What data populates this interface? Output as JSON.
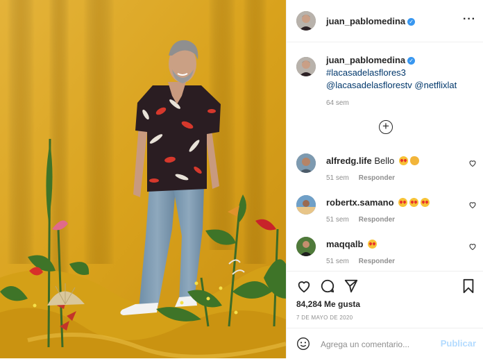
{
  "header": {
    "username": "juan_pablomedina",
    "verified_icon": "verified-badge-icon",
    "more_icon": "more-options-icon"
  },
  "caption": {
    "username": "juan_pablomedina",
    "lines": [
      "#lacasadelasflores3",
      "@lacasadelasflorestv",
      "@netflixlat"
    ],
    "time": "64 sem"
  },
  "load_more_icon": "plus-circle-icon",
  "comments": [
    {
      "username": "alfredg.life",
      "text": "Bello",
      "emojis": [
        "heart-eyes-emoji",
        "clapping-hands-emoji"
      ],
      "time": "51 sem",
      "reply": "Responder"
    },
    {
      "username": "robertx.samano",
      "text": "",
      "emojis": [
        "heart-eyes-emoji",
        "heart-eyes-emoji",
        "heart-eyes-emoji"
      ],
      "time": "51 sem",
      "reply": "Responder"
    },
    {
      "username": "maqqalb",
      "text": "",
      "emojis": [
        "heart-eyes-emoji"
      ],
      "time": "51 sem",
      "reply": "Responder"
    }
  ],
  "actions": {
    "like_icon": "heart-icon",
    "comment_icon": "comment-bubble-icon",
    "share_icon": "paper-plane-icon",
    "save_icon": "bookmark-icon"
  },
  "likes": "84,284 Me gusta",
  "date": "7 DE MAYO DE 2020",
  "add_comment": {
    "placeholder": "Agrega un comentario...",
    "post_label": "Publicar",
    "emoji_icon": "smiley-icon"
  },
  "colors": {
    "accent": "#3897f0",
    "link": "#00376b",
    "muted": "#8e8e8e",
    "post_disabled": "#b3dbff",
    "photo_background": "#d9a31a"
  }
}
